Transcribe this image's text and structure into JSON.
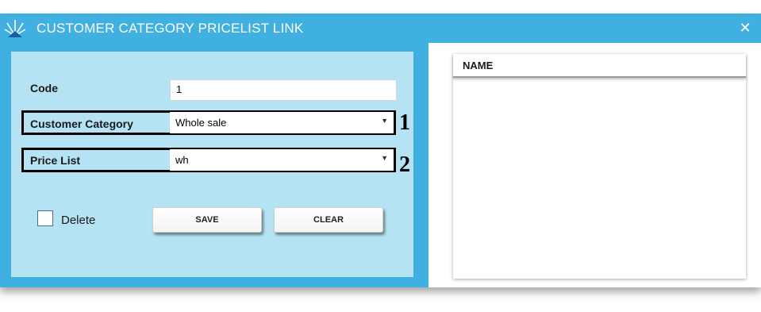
{
  "window": {
    "title": "CUSTOMER CATEGORY PRICELIST LINK",
    "close_symbol": "✕",
    "logo_icon": "app-logo-icon"
  },
  "form": {
    "code_label": "Code",
    "code_value": "1",
    "customer_category_label": "Customer Category",
    "customer_category_value": "Whole sale",
    "price_list_label": "Price List",
    "price_list_value": "wh",
    "delete_label": "Delete",
    "delete_checked": false,
    "save_label": "SAVE",
    "clear_label": "CLEAR",
    "dropdown_arrow": "▼"
  },
  "annotations": {
    "marker_1": "1",
    "marker_2": "2"
  },
  "grid": {
    "columns": [
      "NAME"
    ],
    "rows": []
  },
  "colors": {
    "titlebar": "#3fb0e0",
    "form_panel": "#b5e3f3",
    "highlight_border": "#000000"
  }
}
